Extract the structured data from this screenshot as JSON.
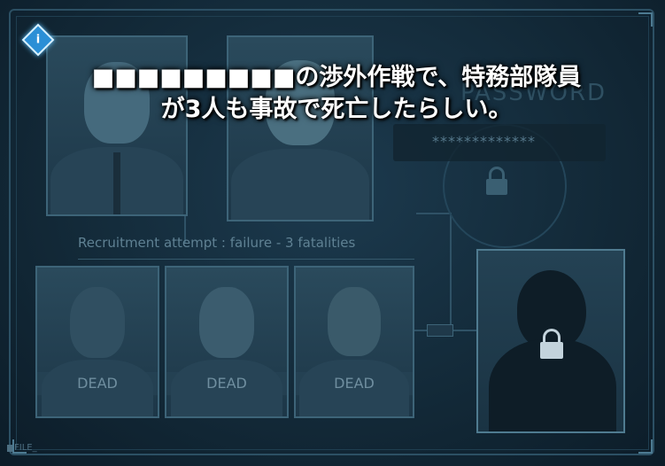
{
  "dialogue": {
    "line1": "■■■■■■■■■の渉外作戦で、特務部隊員",
    "line2": "が3人も事故で死亡したらしい。"
  },
  "info_button": {
    "icon": "info-diamond-icon",
    "glyph": "i",
    "color": "#2b8fd6"
  },
  "record": {
    "text": "Recruitment attempt : failure - 3 fatalities"
  },
  "dossiers": {
    "recruiters": [
      {
        "name": "recruiter-portrait-blond"
      },
      {
        "name": "recruiter-portrait-light-hair"
      }
    ],
    "fatalities": [
      {
        "status": "DEAD"
      },
      {
        "status": "DEAD"
      },
      {
        "status": "DEAD"
      }
    ]
  },
  "password": {
    "word": "PASSWORD",
    "mask": "*************",
    "icon": "lock-icon"
  },
  "unknown_target": {
    "icon": "lock-icon"
  },
  "footer": {
    "label": "FILE_"
  }
}
